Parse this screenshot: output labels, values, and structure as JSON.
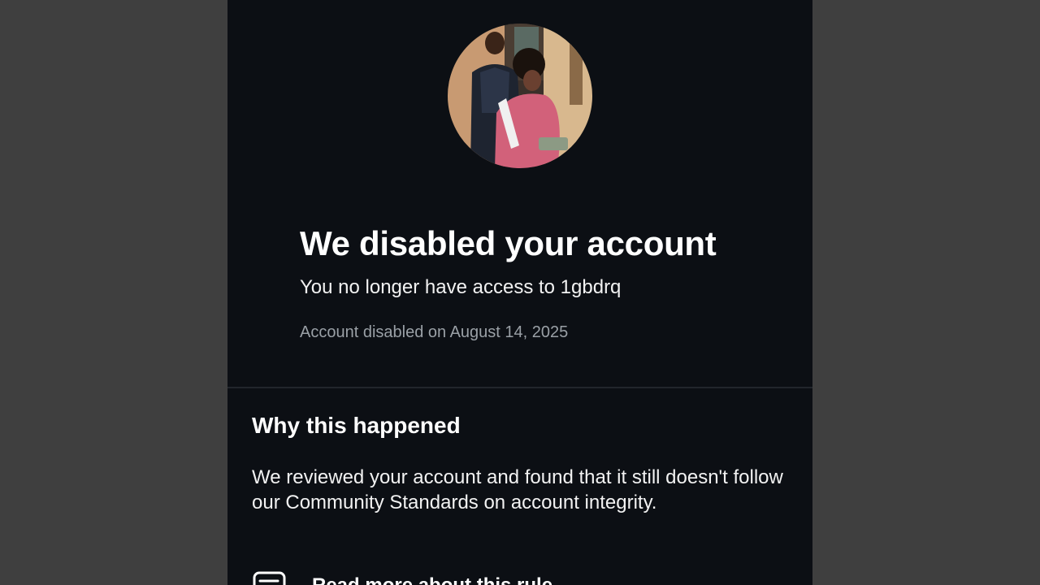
{
  "header": {
    "title": "We disabled your account",
    "subtitle": "You no longer have access to 1gbdrq",
    "disabled_date": "Account disabled on August 14, 2025"
  },
  "reason": {
    "title": "Why this happened",
    "body": "We reviewed your account and found that it still doesn't follow our Community Standards on account integrity.",
    "link_label": "Read more about this rule",
    "link_icon": "document-icon"
  },
  "avatar": {
    "icon": "profile-photo"
  },
  "colors": {
    "background": "#0c0f14",
    "outer_background": "#3f3f3f",
    "text_primary": "#ffffff",
    "text_secondary": "#9aa0a6"
  }
}
